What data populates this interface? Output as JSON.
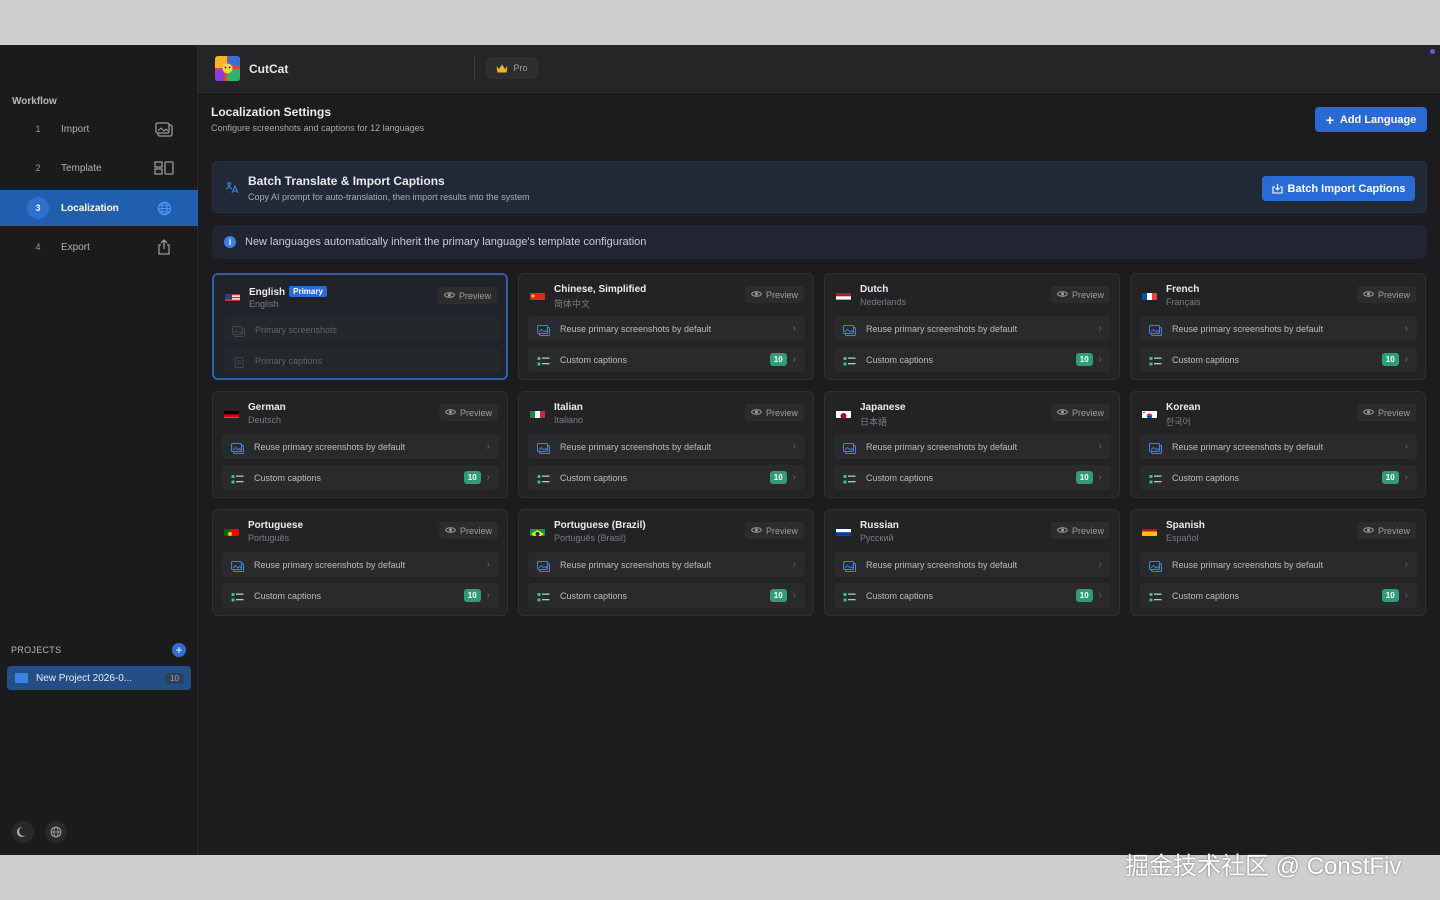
{
  "app": {
    "title": "CutCat",
    "pro_label": "Pro"
  },
  "sidebar": {
    "workflow_label": "Workflow",
    "steps": [
      {
        "num": "1",
        "label": "Import",
        "icon": "image-stack-icon",
        "active": false
      },
      {
        "num": "2",
        "label": "Template",
        "icon": "layout-icon",
        "active": false
      },
      {
        "num": "3",
        "label": "Localization",
        "icon": "globe-icon",
        "active": true
      },
      {
        "num": "4",
        "label": "Export",
        "icon": "share-icon",
        "active": false
      }
    ],
    "projects_label": "PROJECTS",
    "project": {
      "name": "New Project 2026-0...",
      "count": "10"
    }
  },
  "page": {
    "title": "Localization Settings",
    "subtitle": "Configure screenshots and captions for 12 languages",
    "add_language": "Add Language"
  },
  "batch": {
    "title": "Batch Translate & Import Captions",
    "subtitle": "Copy AI prompt for auto-translation, then import results into the system",
    "button": "Batch Import Captions"
  },
  "info_text": "New languages automatically inherit the primary language's template configuration",
  "card_labels": {
    "preview": "Preview",
    "reuse": "Reuse primary screenshots by default",
    "custom": "Custom captions",
    "primary_screens": "Primary screenshots",
    "primary_captions": "Primary captions",
    "primary_tag": "Primary",
    "caption_count": "10"
  },
  "languages": [
    {
      "name": "English",
      "native": "English",
      "flag": "us",
      "primary": true
    },
    {
      "name": "Chinese, Simplified",
      "native": "简体中文",
      "flag": "cn"
    },
    {
      "name": "Dutch",
      "native": "Nederlands",
      "flag": "nl"
    },
    {
      "name": "French",
      "native": "Français",
      "flag": "fr"
    },
    {
      "name": "German",
      "native": "Deutsch",
      "flag": "de"
    },
    {
      "name": "Italian",
      "native": "Italiano",
      "flag": "it"
    },
    {
      "name": "Japanese",
      "native": "日本語",
      "flag": "jp"
    },
    {
      "name": "Korean",
      "native": "한국어",
      "flag": "kr"
    },
    {
      "name": "Portuguese",
      "native": "Português",
      "flag": "pt"
    },
    {
      "name": "Portuguese (Brazil)",
      "native": "Português (Brasil)",
      "flag": "br"
    },
    {
      "name": "Russian",
      "native": "Русский",
      "flag": "ru"
    },
    {
      "name": "Spanish",
      "native": "Español",
      "flag": "es"
    }
  ],
  "watermark": "掘金技术社区 @ ConstFiv",
  "colors": {
    "accent": "#2a6ad4",
    "badge_green": "#2f9d77",
    "background": "#1c1c1e"
  }
}
